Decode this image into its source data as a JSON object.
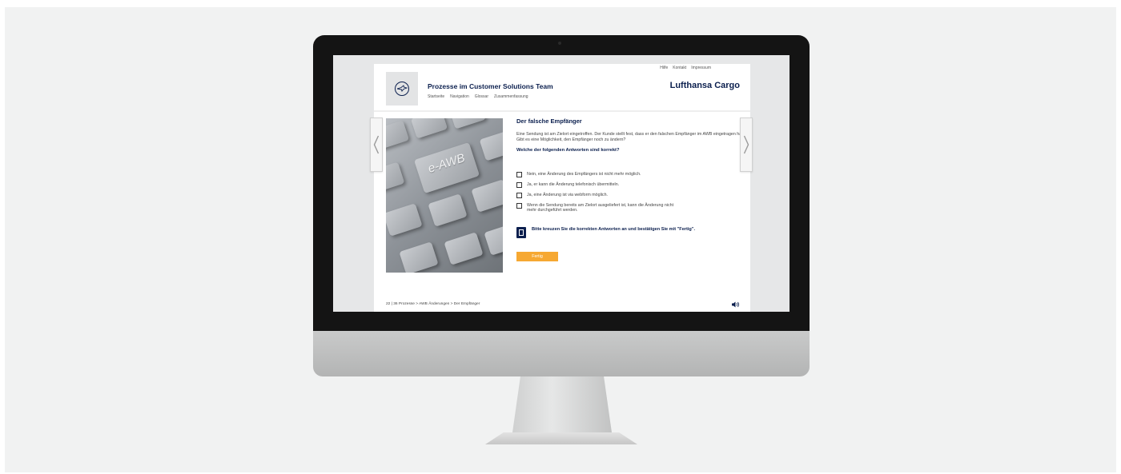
{
  "top_links": [
    "Hilfe",
    "Kontakt",
    "Impressum"
  ],
  "header": {
    "title": "Prozesse im Customer Solutions Team",
    "brand": "Lufthansa Cargo",
    "nav": [
      "Startseite",
      "Navigation",
      "Glossar",
      "Zusammenfassung"
    ]
  },
  "image": {
    "key_label": "e-AWB"
  },
  "question": {
    "title": "Der falsche Empfänger",
    "text": "Eine Sendung ist am Zielort eingetroffen. Der Kunde stellt fest, dass er den falschen Empfänger im AWB eingetragen hat. Gibt es eine Möglichkeit, den Empfänger noch zu ändern?",
    "prompt": "Welche der folgenden Antworten sind korrekt?",
    "options": [
      "Nein, eine Änderung des Empfängers ist nicht mehr möglich.",
      "Ja, er kann die Änderung telefonisch übermitteln.",
      "Ja, eine Änderung ist via webform möglich.",
      "Wenn die Sendung bereits am Zielort ausgeliefert ist, kann die Änderung nicht mehr durchgeführt werden."
    ],
    "hint": "Bitte kreuzen Sie die korrekten Antworten an und bestätigen Sie mit \"Fertig\".",
    "done_label": "Fertig"
  },
  "footer": {
    "path": "22 | 36 Prozesse > AWB Änderungen > Der Empfänger"
  },
  "colors": {
    "brand_navy": "#0b1f4e",
    "accent_orange": "#f6a832"
  }
}
